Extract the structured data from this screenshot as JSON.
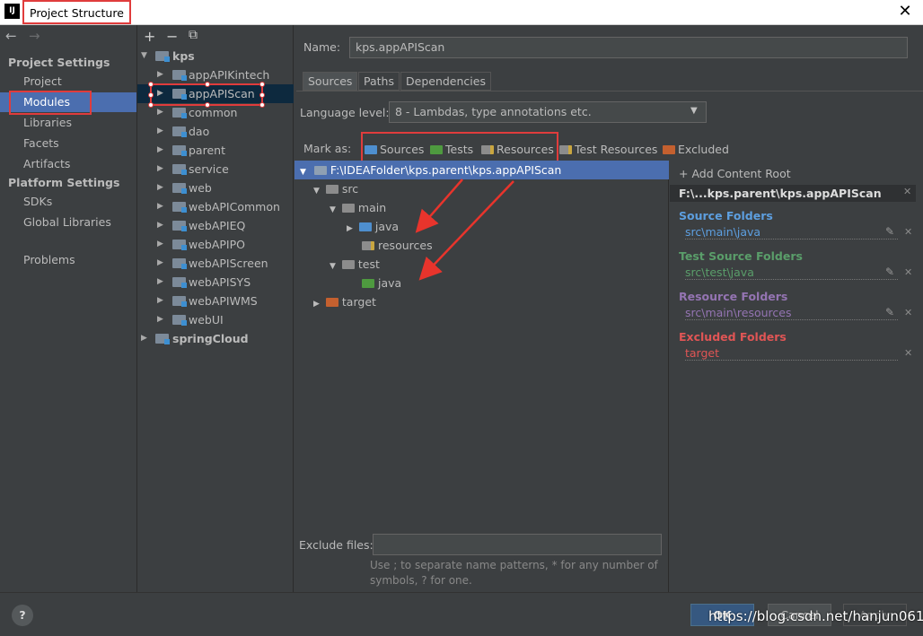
{
  "window": {
    "logo": "IJ",
    "title": "Project Structure",
    "close": "✕"
  },
  "nav": {
    "back": "←",
    "forward": "→",
    "project_settings": "Project Settings",
    "project_items": [
      "Project",
      "Modules",
      "Libraries",
      "Facets",
      "Artifacts"
    ],
    "platform_settings": "Platform Settings",
    "platform_items": [
      "SDKs",
      "Global Libraries"
    ],
    "problems": "Problems",
    "selected": "Modules"
  },
  "tree": {
    "toolbar": {
      "add": "+",
      "remove": "−",
      "copy": "⧉"
    },
    "root": "kps",
    "modules": [
      "appAPIKintech",
      "appAPIScan",
      "common",
      "dao",
      "parent",
      "service",
      "web",
      "webAPICommon",
      "webAPIEQ",
      "webAPIPO",
      "webAPIScreen",
      "webAPISYS",
      "webAPIWMS",
      "webUI"
    ],
    "selected": "appAPIScan",
    "other_root": "springCloud"
  },
  "detail": {
    "name_label": "Name:",
    "name_value": "kps.appAPIScan",
    "tabs": [
      "Sources",
      "Paths",
      "Dependencies"
    ],
    "active_tab": "Sources",
    "language_label": "Language level:",
    "language_value": "8 - Lambdas, type annotations etc.",
    "mark_as_label": "Mark as:",
    "marks": [
      {
        "label": "Sources",
        "color": "#4e8fcf"
      },
      {
        "label": "Tests",
        "color": "#4e9a3f"
      },
      {
        "label": "Resources",
        "color": "#8c8c8c"
      },
      {
        "label": "Test Resources",
        "color": "#8c8c8c"
      },
      {
        "label": "Excluded",
        "color": "#c4602f"
      }
    ],
    "content_tree": {
      "root": "F:\\IDEAFolder\\kps.parent\\kps.appAPIScan",
      "src": "src",
      "main": "main",
      "main_java": "java",
      "resources": "resources",
      "test": "test",
      "test_java": "java",
      "target": "target"
    },
    "exclude_label": "Exclude files:",
    "exclude_value": "",
    "exclude_help": "Use ; to separate name patterns, * for any number of symbols, ? for one."
  },
  "roots": {
    "add": "+ Add Content Root",
    "header": "F:\\...kps.parent\\kps.appAPIScan",
    "source_title": "Source Folders",
    "source_path": "src\\main\\java",
    "test_title": "Test Source Folders",
    "test_path": "src\\test\\java",
    "resource_title": "Resource Folders",
    "resource_path": "src\\main\\resources",
    "excluded_title": "Excluded Folders",
    "excluded_path": "target",
    "colors": {
      "source": "#5d9fe0",
      "test": "#5a9e6a",
      "resource": "#9474b2",
      "excluded": "#e05555"
    }
  },
  "buttons": {
    "help": "?",
    "ok": "OK",
    "cancel": "Cancel",
    "apply": "Apply"
  },
  "watermark": "https://blog.csdn.net/hanjun0612"
}
